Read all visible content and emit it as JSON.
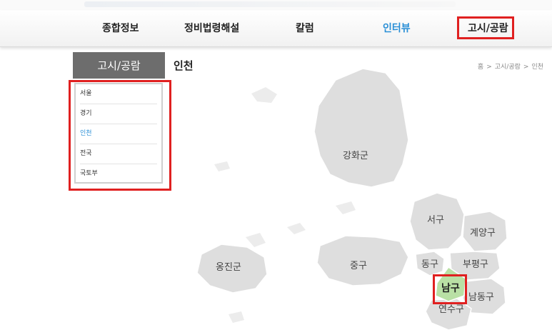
{
  "nav": {
    "items": [
      {
        "label": "종합정보",
        "active": false
      },
      {
        "label": "정비법령해설",
        "active": false
      },
      {
        "label": "칼럼",
        "active": false
      },
      {
        "label": "인터뷰",
        "active": true
      },
      {
        "label": "고시/공람",
        "active": false
      }
    ]
  },
  "sidebar": {
    "tab_label": "고시/공람",
    "items": [
      {
        "label": "서울",
        "active": false
      },
      {
        "label": "경기",
        "active": false
      },
      {
        "label": "인천",
        "active": true
      },
      {
        "label": "전국",
        "active": false
      },
      {
        "label": "국토부",
        "active": false
      }
    ]
  },
  "page": {
    "title": "인천",
    "breadcrumb": [
      "홈",
      "고시/공람",
      "인천"
    ],
    "breadcrumb_separator": ">"
  },
  "map": {
    "regions": [
      {
        "label": "강화군",
        "selected": false
      },
      {
        "label": "서구",
        "selected": false
      },
      {
        "label": "계양구",
        "selected": false
      },
      {
        "label": "옹진군",
        "selected": false
      },
      {
        "label": "중구",
        "selected": false
      },
      {
        "label": "동구",
        "selected": false
      },
      {
        "label": "부평구",
        "selected": false
      },
      {
        "label": "남구",
        "selected": true
      },
      {
        "label": "남동구",
        "selected": false
      },
      {
        "label": "연수구",
        "selected": false
      }
    ]
  },
  "colors": {
    "nav_active": "#2a8fd6",
    "highlight": "#e02020",
    "region_fill": "#dedede",
    "region_selected": "#b9e0a5",
    "side_tab_bg": "#6d6d6d"
  }
}
